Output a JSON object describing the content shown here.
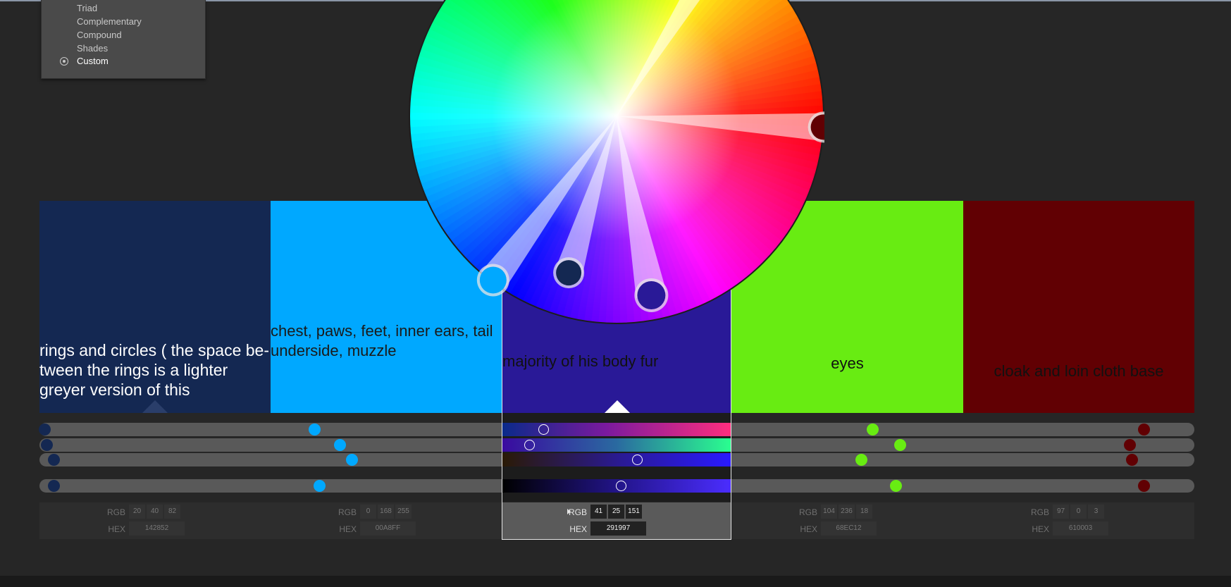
{
  "harmony_rules": {
    "items": [
      {
        "label": "Triad",
        "selected": false
      },
      {
        "label": "Complementary",
        "selected": false
      },
      {
        "label": "Compound",
        "selected": false
      },
      {
        "label": "Shades",
        "selected": false
      },
      {
        "label": "Custom",
        "selected": true
      }
    ]
  },
  "swatches": [
    {
      "hex": "142852",
      "color": "#142852",
      "label_lines": [
        "rings and circles ( the space be-",
        "tween the rings is a lighter",
        "greyer version of this"
      ],
      "label_color": "#ffffff",
      "rgb": [
        "20",
        "40",
        "82"
      ],
      "selected": false
    },
    {
      "hex": "00A8FF",
      "color": "#00A8FF",
      "label_lines": [
        "chest, paws, feet, inner ears, tail",
        "underside, muzzle"
      ],
      "label_color": "#1a1a1a",
      "rgb": [
        "0",
        "168",
        "255"
      ],
      "selected": false
    },
    {
      "hex": "291997",
      "color": "#291997",
      "label_lines": [
        "majority of his body fur"
      ],
      "label_color": "#111111",
      "rgb": [
        "41",
        "25",
        "151"
      ],
      "selected": true
    },
    {
      "hex": "68EC12",
      "color": "#68EC12",
      "label_lines": [
        "eyes"
      ],
      "label_color": "#111111",
      "rgb": [
        "104",
        "236",
        "18"
      ],
      "selected": false
    },
    {
      "hex": "610003",
      "color": "#610003",
      "label_lines": [
        "cloak and loin cloth base"
      ],
      "label_color": "#111111",
      "rgb": [
        "97",
        "0",
        "3"
      ],
      "selected": false
    }
  ],
  "value_labels": {
    "rgb": "RGB",
    "hex": "HEX"
  },
  "sliders": {
    "selected_knobs": [
      0.18,
      0.12,
      0.59,
      0.52
    ],
    "row_dots": [
      [
        0.02,
        0.19,
        0.61,
        0.78
      ],
      [
        0.03,
        0.3,
        0.73,
        0.72
      ],
      [
        0.06,
        0.35,
        0.56,
        0.73
      ],
      [
        0.06,
        0.21,
        0.71,
        0.78
      ]
    ]
  },
  "wheel": {
    "handles": [
      {
        "name": "handle-green",
        "angle_deg": -58,
        "dist": 0.95,
        "color": "#68EC12",
        "r": 16
      },
      {
        "name": "handle-red",
        "angle_deg": 3,
        "dist": 1.0,
        "color": "#610003",
        "r": 18
      },
      {
        "name": "handle-cyan",
        "angle_deg": 127,
        "dist": 0.99,
        "color": "#00A8FF",
        "r": 19
      },
      {
        "name": "handle-navy",
        "angle_deg": 107,
        "dist": 0.79,
        "color": "#142852",
        "r": 18
      },
      {
        "name": "handle-purple",
        "angle_deg": 79,
        "dist": 0.88,
        "color": "#291997",
        "r": 20
      }
    ]
  }
}
